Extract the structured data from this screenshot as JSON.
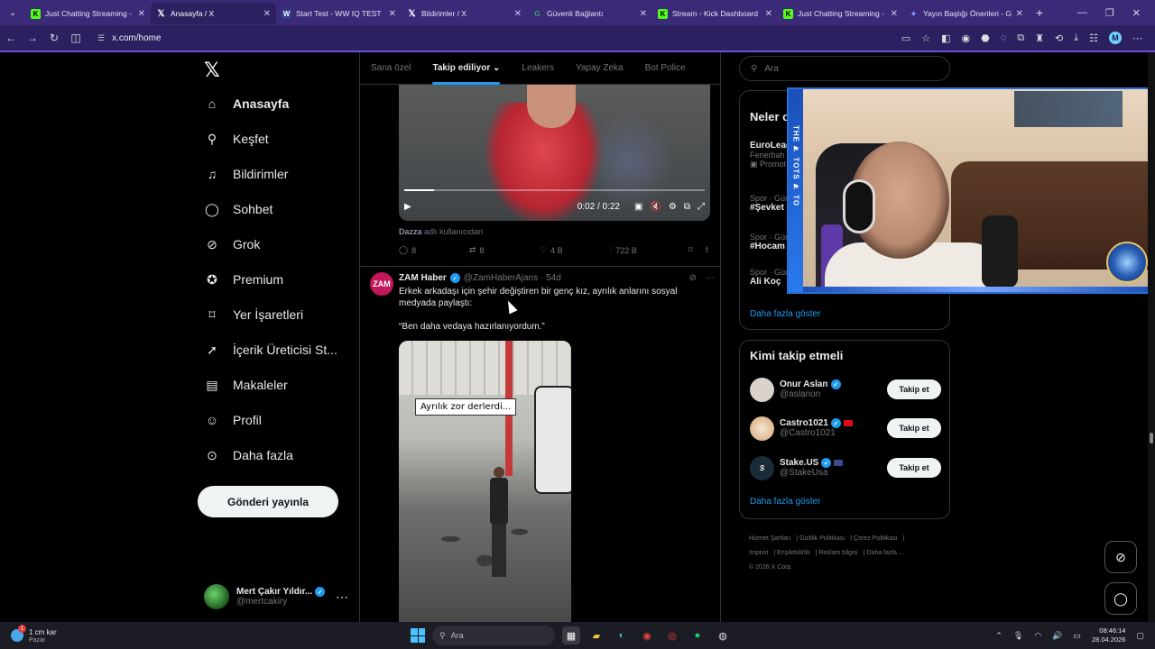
{
  "browser": {
    "tabs": [
      {
        "title": "Just Chatting Streaming - ",
        "icon": "kick-icon",
        "active": false
      },
      {
        "title": "Anasayfa / X",
        "icon": "x-icon",
        "active": true
      },
      {
        "title": "Start Test - WW IQ TEST",
        "icon": "ww-icon",
        "active": false
      },
      {
        "title": "Bildirimler / X",
        "icon": "x-icon",
        "active": false
      },
      {
        "title": "Güvenli Bağlantı",
        "icon": "shield-icon",
        "active": false
      },
      {
        "title": "Stream - Kick Dashboard",
        "icon": "kick-icon",
        "active": false
      },
      {
        "title": "Just Chatting Streaming - ",
        "icon": "kick-icon",
        "active": false
      },
      {
        "title": "Yayın Başlığı Önerileri - G",
        "icon": "gemini-icon",
        "active": false
      }
    ],
    "url": "x.com/home",
    "profile_initial": "M"
  },
  "sidebar": {
    "logo": "𝕏",
    "items": [
      {
        "label": "Anasayfa",
        "icon": "home-icon",
        "glyph": "⌂",
        "bold": true
      },
      {
        "label": "Keşfet",
        "icon": "search-icon",
        "glyph": "⚲"
      },
      {
        "label": "Bildirimler",
        "icon": "bell-icon",
        "glyph": "🔔"
      },
      {
        "label": "Sohbet",
        "icon": "chat-icon",
        "glyph": "◯"
      },
      {
        "label": "Grok",
        "icon": "grok-icon",
        "glyph": "⊘"
      },
      {
        "label": "Premium",
        "icon": "premium-icon",
        "glyph": "✪"
      },
      {
        "label": "Yer İşaretleri",
        "icon": "bookmark-icon",
        "glyph": "⌑"
      },
      {
        "label": "İçerik Üreticisi St...",
        "icon": "rocket-icon",
        "glyph": "➚"
      },
      {
        "label": "Makaleler",
        "icon": "article-icon",
        "glyph": "▤"
      },
      {
        "label": "Profil",
        "icon": "profile-icon",
        "glyph": "👤"
      },
      {
        "label": "Daha fazla",
        "icon": "more-icon",
        "glyph": "⋯"
      }
    ],
    "post_button": "Gönderi yayınla",
    "account": {
      "name": "Mert Çakır Yıldır...",
      "handle": "@mertcakiry"
    }
  },
  "feed": {
    "tabs": [
      {
        "label": "Sana özel",
        "active": false
      },
      {
        "label": "Takip ediliyor",
        "active": true
      },
      {
        "label": "Leakers",
        "active": false
      },
      {
        "label": "Yapay Zeka",
        "active": false
      },
      {
        "label": "Bot Police",
        "active": false
      }
    ],
    "video1": {
      "time": "0:02 / 0:22",
      "progress": 0.1
    },
    "credit": {
      "user": "Dazza",
      "suffix": "adlı kullanıcıdan"
    },
    "actions": {
      "replies": "8",
      "reposts": "8",
      "likes": "4 B",
      "views": "722 B"
    },
    "tweet2": {
      "avatar": "ZAM",
      "name": "ZAM Haber",
      "handle": "@ZamHaberAjans · 54d",
      "text": "Erkek arkadaşı için şehir değiştiren bir genç kız, ayrılık anlarını sosyal medyada paylaştı:",
      "quote": "“Ben daha vedaya hazırlanıyordum.”",
      "video_caption": "Ayrılık zor derlerdi..."
    }
  },
  "right": {
    "search_placeholder": "Ara",
    "whats_happening_title": "Neler o",
    "trends": [
      {
        "meta": "",
        "title": "EuroLeag",
        "sub": "Fenerbah",
        "extra": "Promot"
      },
      {
        "meta": "Spor · Gün",
        "title": "#Şevket",
        "sub": "",
        "extra": ""
      },
      {
        "meta": "Spor · Gün",
        "title": "#Hocam",
        "sub": "",
        "extra": ""
      },
      {
        "meta": "Spor · Gün",
        "title": "Ali Koç",
        "sub": "",
        "extra": ""
      }
    ],
    "more_link": "Daha fazla göster",
    "follow_title": "Kimi takip etmeli",
    "follow_users": [
      {
        "name": "Onur Aslan",
        "handle": "@aslanon",
        "button": "Takip et",
        "avatar_color": "#d9d3cc"
      },
      {
        "name": "Castro1021",
        "handle": "@Castro1021",
        "button": "Takip et",
        "avatar_color": "#f1e4d6"
      },
      {
        "name": "Stake.US",
        "handle": "@StakeUsa",
        "button": "Takip et",
        "avatar_color": "#1a2c38"
      }
    ],
    "follow_more": "Daha fazla göster",
    "footer": [
      "Hizmet Şartları",
      "Gizlilik Politikası",
      "Çerez Politikası",
      "Imprint",
      "Erişilebilirlik",
      "Reklam bilgisi",
      "Daha fazla ...",
      "© 2026 X Corp."
    ]
  },
  "webcam": {
    "strip_text": "THE ⚑ TOTS ⚑ TO"
  },
  "taskbar": {
    "weather_temp": "1 cm kar",
    "weather_sub": "Pazar",
    "notif_count": "1",
    "search_placeholder": "Ara",
    "time": "08:46:14",
    "date": "28.04.2026"
  },
  "colors": {
    "accent": "#1d9bf0",
    "tab_bg": "#3b2a78",
    "kick": "#53fc18"
  }
}
